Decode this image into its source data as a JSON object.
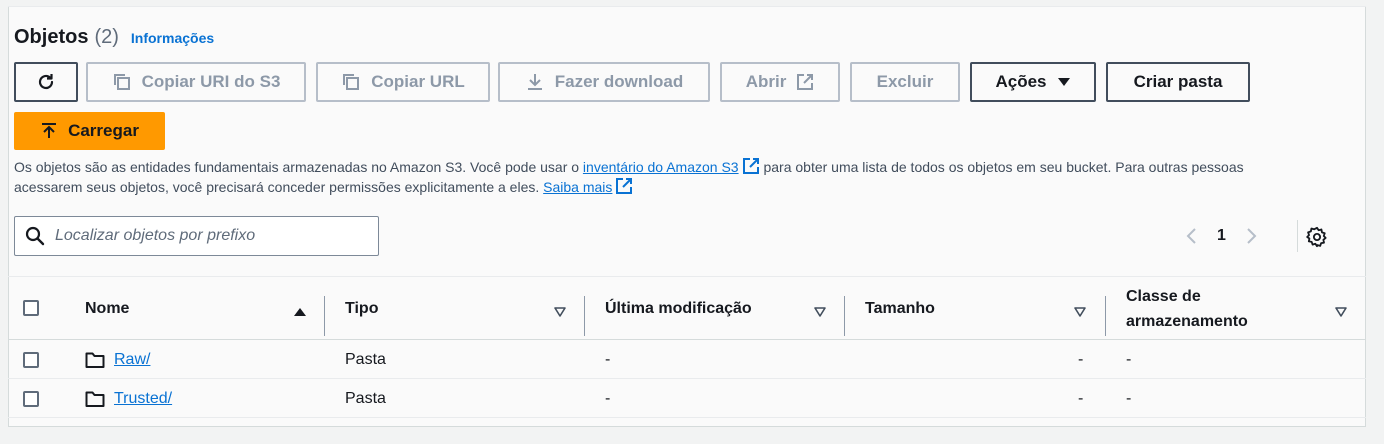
{
  "header": {
    "title": "Objetos",
    "count": "(2)",
    "info_link": "Informações"
  },
  "toolbar": {
    "copy_uri": "Copiar URI do S3",
    "copy_url": "Copiar URL",
    "download": "Fazer download",
    "open": "Abrir",
    "delete": "Excluir",
    "actions": "Ações",
    "create_folder": "Criar pasta",
    "upload": "Carregar"
  },
  "description": {
    "part1": "Os objetos são as entidades fundamentais armazenadas no Amazon S3. Você pode usar o ",
    "link1": "inventário do Amazon S3",
    "part2": " para obter uma lista de todos os objetos em seu bucket. Para outras pessoas acessarem seus objetos, você precisará conceder permissões explicitamente a eles. ",
    "link2": "Saiba mais"
  },
  "search": {
    "placeholder": "Localizar objetos por prefixo"
  },
  "pagination": {
    "current_page": "1"
  },
  "table": {
    "columns": {
      "name": "Nome",
      "type": "Tipo",
      "modified": "Última modificação",
      "size": "Tamanho",
      "storage_class_line1": "Classe de",
      "storage_class_line2": "armazenamento"
    },
    "rows": [
      {
        "name": "Raw/",
        "type": "Pasta",
        "modified": "-",
        "size": "-",
        "storage_class": "-"
      },
      {
        "name": "Trusted/",
        "type": "Pasta",
        "modified": "-",
        "size": "-",
        "storage_class": "-"
      }
    ]
  },
  "colors": {
    "primary": "#ff9900",
    "link": "#0972d3",
    "disabled_text": "#8d99a8"
  }
}
